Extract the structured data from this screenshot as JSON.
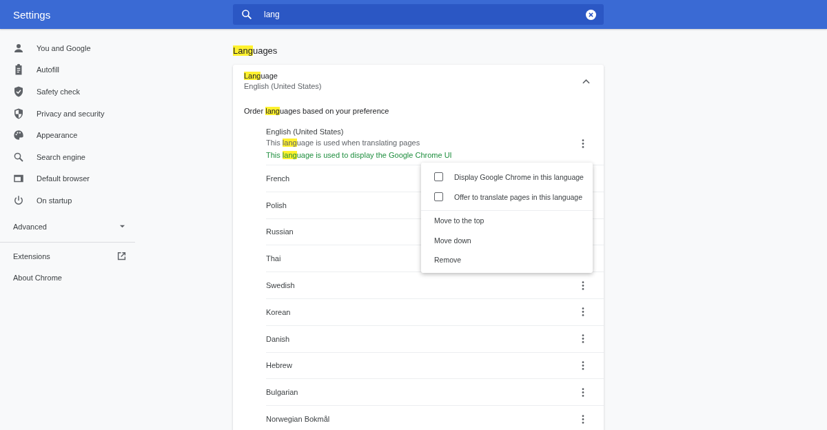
{
  "header": {
    "title": "Settings",
    "search": {
      "value": "lang"
    }
  },
  "sidebar": {
    "items": [
      {
        "label": "You and Google",
        "kind": "person"
      },
      {
        "label": "Autofill",
        "kind": "clipboard"
      },
      {
        "label": "Safety check",
        "kind": "shield-check"
      },
      {
        "label": "Privacy and security",
        "kind": "shield"
      },
      {
        "label": "Appearance",
        "kind": "palette"
      },
      {
        "label": "Search engine",
        "kind": "search"
      },
      {
        "label": "Default browser",
        "kind": "browser"
      },
      {
        "label": "On startup",
        "kind": "power"
      }
    ],
    "advanced": {
      "label": "Advanced",
      "expanded": false
    },
    "links": [
      {
        "label": "Extensions",
        "external": true
      },
      {
        "label": "About Chrome",
        "external": false
      }
    ]
  },
  "section": {
    "title": [
      {
        "text": "Lang",
        "highlight": true
      },
      {
        "text": "uages",
        "highlight": false
      }
    ]
  },
  "card": {
    "title": [
      {
        "text": "Lang",
        "highlight": true
      },
      {
        "text": "uage",
        "highlight": false
      }
    ],
    "value": "English (United States)",
    "expanded": true,
    "order_label": [
      {
        "text": "Order ",
        "highlight": false
      },
      {
        "text": "lang",
        "highlight": true
      },
      {
        "text": "uages based on your preference",
        "highlight": false
      }
    ],
    "languages": [
      {
        "name": "English (United States)",
        "more_button": true,
        "notes": [
          {
            "kind": "info",
            "parts": [
              {
                "text": "This ",
                "highlight": false
              },
              {
                "text": "lang",
                "highlight": true
              },
              {
                "text": "uage is used when translating pages",
                "highlight": false
              }
            ]
          },
          {
            "kind": "ui",
            "parts": [
              {
                "text": "This ",
                "highlight": false
              },
              {
                "text": "lang",
                "highlight": true
              },
              {
                "text": "uage is used to display the Google Chrome UI",
                "highlight": false
              }
            ]
          }
        ]
      },
      {
        "name": "French",
        "more_button": false
      },
      {
        "name": "Polish",
        "more_button": false
      },
      {
        "name": "Russian",
        "more_button": false
      },
      {
        "name": "Thai",
        "more_button": false
      },
      {
        "name": "Swedish",
        "more_button": true
      },
      {
        "name": "Korean",
        "more_button": true
      },
      {
        "name": "Danish",
        "more_button": true
      },
      {
        "name": "Hebrew",
        "more_button": true
      },
      {
        "name": "Bulgarian",
        "more_button": true
      },
      {
        "name": "Norwegian Bokmål",
        "more_button": true
      }
    ]
  },
  "context_menu": {
    "checkboxes": [
      {
        "label": "Display Google Chrome in this language",
        "checked": false
      },
      {
        "label": "Offer to translate pages in this language",
        "checked": false
      }
    ],
    "actions": [
      "Move to the top",
      "Move down",
      "Remove"
    ]
  }
}
